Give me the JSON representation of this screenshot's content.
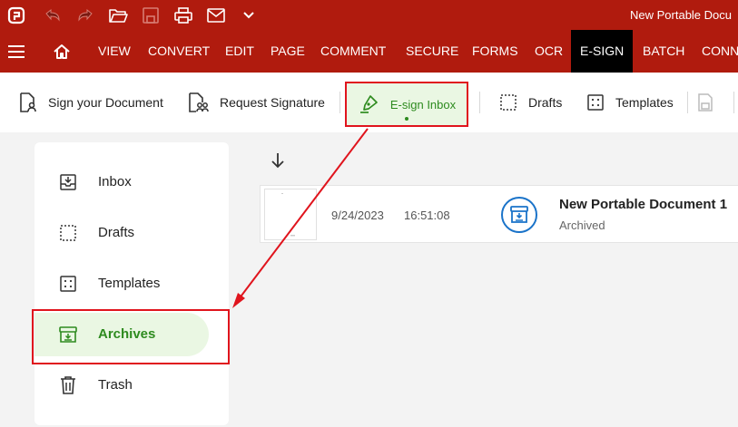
{
  "app": {
    "document_title": "New Portable Docu"
  },
  "menu": {
    "items": [
      {
        "label": "VIEW"
      },
      {
        "label": "CONVERT"
      },
      {
        "label": "EDIT"
      },
      {
        "label": "PAGE"
      },
      {
        "label": "COMMENT"
      },
      {
        "label": "SECURE"
      },
      {
        "label": "FORMS"
      },
      {
        "label": "OCR"
      },
      {
        "label": "E-SIGN",
        "active": true
      },
      {
        "label": "BATCH"
      },
      {
        "label": "CONN"
      }
    ]
  },
  "toolbar": {
    "sign_document": "Sign your Document",
    "request_signature": "Request Signature",
    "esign_inbox": "E-sign Inbox",
    "drafts": "Drafts",
    "templates": "Templates"
  },
  "sidebar": {
    "items": [
      {
        "label": "Inbox",
        "icon": "inbox-icon"
      },
      {
        "label": "Drafts",
        "icon": "drafts-icon"
      },
      {
        "label": "Templates",
        "icon": "templates-icon"
      },
      {
        "label": "Archives",
        "icon": "archive-icon",
        "active": true
      },
      {
        "label": "Trash",
        "icon": "trash-icon"
      }
    ]
  },
  "documents": [
    {
      "date": "9/24/2023",
      "time": "16:51:08",
      "name": "New Portable Document 1",
      "status": "Archived"
    }
  ],
  "colors": {
    "brand_red": "#b01b0e",
    "accent_green": "#2e8b1f",
    "highlight_green": "#eaf7e3",
    "annotation_red": "#e0141d",
    "status_blue": "#1a73c9"
  }
}
